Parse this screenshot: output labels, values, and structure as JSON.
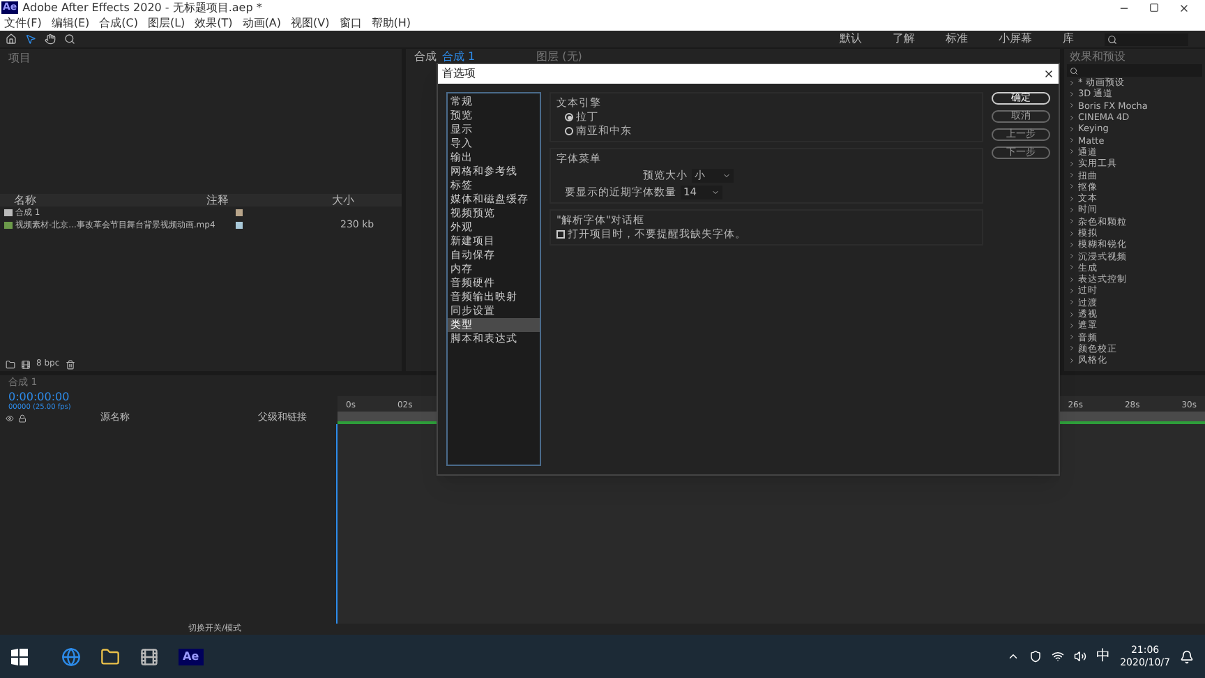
{
  "window": {
    "app_icon": "Ae",
    "title": "Adobe After Effects 2020 - 无标题项目.aep *"
  },
  "menu": [
    "文件(F)",
    "编辑(E)",
    "合成(C)",
    "图层(L)",
    "效果(T)",
    "动画(A)",
    "视图(V)",
    "窗口",
    "帮助(H)"
  ],
  "workspaces": [
    "默认",
    "了解",
    "标准",
    "小屏幕",
    "库"
  ],
  "project_panel": {
    "title": "项目",
    "columns": [
      "名称",
      "注释",
      "大小"
    ],
    "items": [
      {
        "name": "合成 1",
        "kind": "comp"
      },
      {
        "name": "视频素材-北京...事改革会节目舞台背景视频动画.mp4",
        "size": "230 kb",
        "kind": "footage"
      }
    ],
    "bpc": "8 bpc"
  },
  "comp_panel": {
    "tab_prefix": "合成",
    "tab": "合成 1",
    "layer_tab": "图层 (无)"
  },
  "preferences_dialog": {
    "title": "首选项",
    "categories": [
      {
        "label": "常规",
        "selected": false
      },
      {
        "label": "预览",
        "selected": false
      },
      {
        "label": "显示",
        "selected": false
      },
      {
        "label": "导入",
        "selected": false
      },
      {
        "label": "输出",
        "selected": false
      },
      {
        "label": "网格和参考线",
        "selected": false
      },
      {
        "label": "标签",
        "selected": false
      },
      {
        "label": "媒体和磁盘缓存",
        "selected": false
      },
      {
        "label": "视频预览",
        "selected": false
      },
      {
        "label": "外观",
        "selected": false
      },
      {
        "label": "新建项目",
        "selected": false
      },
      {
        "label": "自动保存",
        "selected": false
      },
      {
        "label": "内存",
        "selected": false
      },
      {
        "label": "音频硬件",
        "selected": false
      },
      {
        "label": "音频输出映射",
        "selected": false
      },
      {
        "label": "同步设置",
        "selected": false
      },
      {
        "label": "类型",
        "selected": true
      },
      {
        "label": "脚本和表达式",
        "selected": false
      }
    ],
    "text_engine": {
      "title": "文本引擎",
      "options": [
        {
          "label": "拉丁",
          "selected": true
        },
        {
          "label": "南亚和中东",
          "selected": false
        }
      ]
    },
    "font_menu": {
      "title": "字体菜单",
      "preview_size_label": "预览大小",
      "preview_size": "小",
      "recent_fonts_label": "要显示的近期字体数量",
      "recent_fonts": "14"
    },
    "resolve_fonts": {
      "title": "\"解析字体\"对话框",
      "label": "打开项目时，不要提醒我缺失字体。",
      "checked": false
    },
    "buttons": [
      "确定",
      "取消",
      "上一步",
      "下一步"
    ]
  },
  "effects_panel": {
    "title": "效果和预设",
    "items": [
      "* 动画预设",
      "3D 通道",
      "Boris FX Mocha",
      "CINEMA 4D",
      "Keying",
      "Matte",
      "通道",
      "实用工具",
      "扭曲",
      "抠像",
      "文本",
      "时间",
      "杂色和颗粒",
      "模拟",
      "模糊和锐化",
      "沉浸式视频",
      "生成",
      "表达式控制",
      "过时",
      "过渡",
      "透视",
      "遮罩",
      "音频",
      "颜色校正",
      "风格化"
    ]
  },
  "timeline": {
    "tab": "合成 1",
    "timecode": "0:00:00:00",
    "frame_info": "00000 (25.00 fps)",
    "columns": [
      "源名称",
      "父级和链接"
    ],
    "ruler_left": [
      "0s",
      "02s"
    ],
    "ruler_right": [
      "26s",
      "28s",
      "30s"
    ],
    "footer": "切换开关/模式"
  },
  "taskbar": {
    "ae_icon": "Ae",
    "time": "21:06",
    "date": "2020/10/7",
    "ime": "中"
  }
}
